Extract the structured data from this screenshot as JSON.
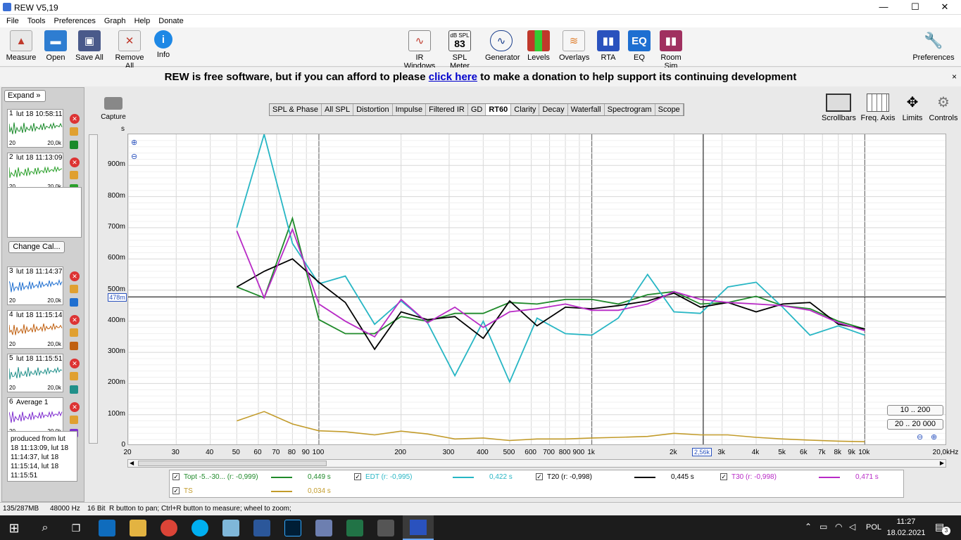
{
  "window": {
    "title": "REW V5,19",
    "min": "—",
    "max": "☐",
    "close": "✕"
  },
  "menu": [
    "File",
    "Tools",
    "Preferences",
    "Graph",
    "Help",
    "Donate"
  ],
  "toolbar": {
    "left": [
      {
        "label": "Measure",
        "icon": "measure-icon",
        "color": "#c0392b"
      },
      {
        "label": "Open",
        "icon": "folder-icon",
        "color": "#2e7dd1"
      },
      {
        "label": "Save All",
        "icon": "save-icon",
        "color": "#4a5a8a"
      },
      {
        "label": "Remove All",
        "icon": "remove-icon",
        "color": "#c0392b"
      },
      {
        "label": "Info",
        "icon": "info-icon",
        "color": "#1e88e5"
      }
    ],
    "center": [
      {
        "label": "IR Windows",
        "icon": "ir-windows-icon",
        "color": "#c0392b"
      },
      {
        "label": "SPL Meter",
        "icon": "spl-meter-icon",
        "color": "#333",
        "top": "dB SPL",
        "value": "83"
      },
      {
        "label": "Generator",
        "icon": "generator-icon",
        "color": "#1a3e8c"
      },
      {
        "label": "Levels",
        "icon": "levels-icon",
        "color": "#c0392b"
      },
      {
        "label": "Overlays",
        "icon": "overlays-icon",
        "color": "#e08030"
      },
      {
        "label": "RTA",
        "icon": "rta-icon",
        "color": "#2a52be"
      },
      {
        "label": "EQ",
        "icon": "eq-icon",
        "color": "#1e6fd1"
      },
      {
        "label": "Room Sim",
        "icon": "room-sim-icon",
        "color": "#a03060"
      }
    ],
    "right": {
      "label": "Preferences",
      "icon": "wrench-icon"
    }
  },
  "donate": {
    "pre": "REW is free software, but if you can afford to please ",
    "link": "click here",
    "post": " to make a donation to help support its continuing development",
    "close": "×"
  },
  "left_panel": {
    "expand": "Expand",
    "change_cal": "Change Cal...",
    "measurements": [
      {
        "num": "1",
        "date": "lut 18 10:58:11",
        "lo": "20",
        "hi": "20,0k",
        "color": "#1a8a2a"
      },
      {
        "num": "2",
        "date": "lut 18 11:13:09",
        "lo": "20",
        "hi": "20,0k",
        "color": "#2aa02a"
      },
      {
        "num": "3",
        "date": "lut 18 11:14:37",
        "lo": "20",
        "hi": "20,0k",
        "color": "#1f6fd0"
      },
      {
        "num": "4",
        "date": "lut 18 11:15:14",
        "lo": "20",
        "hi": "20,0k",
        "color": "#c06010"
      },
      {
        "num": "5",
        "date": "lut 18 11:15:51",
        "lo": "20",
        "hi": "20,0k",
        "color": "#20908a"
      },
      {
        "num": "6",
        "date": "Average 1",
        "lo": "20",
        "hi": "20,0k",
        "color": "#8030d0"
      }
    ],
    "notes": [
      "produced from lut",
      "18 11:13:09, lut 18",
      "11:14:37, lut 18",
      "11:15:14, lut 18",
      "11:15:51"
    ]
  },
  "graph": {
    "capture": "Capture",
    "tabs": [
      "SPL & Phase",
      "All SPL",
      "Distortion",
      "Impulse",
      "Filtered IR",
      "GD",
      "RT60",
      "Clarity",
      "Decay",
      "Waterfall",
      "Spectrogram",
      "Scope"
    ],
    "active_tab": "RT60",
    "right_tools": [
      "Scrollbars",
      "Freq. Axis",
      "Limits",
      "Controls"
    ],
    "y_unit": "s",
    "cursor_y": "478m",
    "cursor_x": "2,56k",
    "range_buttons": [
      "10 .. 200",
      "20 .. 20 000"
    ]
  },
  "chart_data": {
    "type": "line",
    "x_scale": "log",
    "xlim": [
      20,
      20000
    ],
    "ylim": [
      0,
      1
    ],
    "y_ticks": [
      {
        "v": 0,
        "label": "0"
      },
      {
        "v": 0.1,
        "label": "100m"
      },
      {
        "v": 0.2,
        "label": "200m"
      },
      {
        "v": 0.3,
        "label": "300m"
      },
      {
        "v": 0.4,
        "label": "400m"
      },
      {
        "v": 0.5,
        "label": "500m"
      },
      {
        "v": 0.6,
        "label": "600m"
      },
      {
        "v": 0.7,
        "label": "700m"
      },
      {
        "v": 0.8,
        "label": "800m"
      },
      {
        "v": 0.9,
        "label": "900m"
      }
    ],
    "x_ticks": [
      {
        "v": 20,
        "label": "20"
      },
      {
        "v": 30,
        "label": "30"
      },
      {
        "v": 40,
        "label": "40"
      },
      {
        "v": 50,
        "label": "50"
      },
      {
        "v": 60,
        "label": "60"
      },
      {
        "v": 70,
        "label": "70"
      },
      {
        "v": 80,
        "label": "80"
      },
      {
        "v": 90,
        "label": "90"
      },
      {
        "v": 100,
        "label": "100"
      },
      {
        "v": 200,
        "label": "200"
      },
      {
        "v": 300,
        "label": "300"
      },
      {
        "v": 400,
        "label": "400"
      },
      {
        "v": 500,
        "label": "500"
      },
      {
        "v": 600,
        "label": "600"
      },
      {
        "v": 700,
        "label": "700"
      },
      {
        "v": 800,
        "label": "800"
      },
      {
        "v": 900,
        "label": "900"
      },
      {
        "v": 1000,
        "label": "1k"
      },
      {
        "v": 2000,
        "label": "2k"
      },
      {
        "v": 3000,
        "label": "3k"
      },
      {
        "v": 4000,
        "label": "4k"
      },
      {
        "v": 5000,
        "label": "5k"
      },
      {
        "v": 6000,
        "label": "6k"
      },
      {
        "v": 7000,
        "label": "7k"
      },
      {
        "v": 8000,
        "label": "8k"
      },
      {
        "v": 9000,
        "label": "9k"
      },
      {
        "v": 10000,
        "label": "10k"
      },
      {
        "v": 20000,
        "label": "20,0kHz"
      }
    ],
    "x": [
      50,
      63,
      80,
      100,
      125,
      160,
      200,
      250,
      315,
      400,
      500,
      630,
      800,
      1000,
      1250,
      1600,
      2000,
      2500,
      3150,
      4000,
      5000,
      6300,
      8000,
      10000
    ],
    "cursor": {
      "x": 2560,
      "y": 0.478
    },
    "series": [
      {
        "name": "Topt -5..-30... (r: -0,999)",
        "value": "0,449 s",
        "color": "#1f8a2a",
        "y": [
          0.51,
          0.475,
          0.73,
          0.405,
          0.36,
          0.36,
          0.415,
          0.4,
          0.425,
          0.425,
          0.46,
          0.455,
          0.47,
          0.47,
          0.455,
          0.485,
          0.495,
          0.455,
          0.46,
          0.48,
          0.45,
          0.44,
          0.4,
          0.375
        ]
      },
      {
        "name": "EDT (r: -0,995)",
        "value": "0,422 s",
        "color": "#27b6c4",
        "y": [
          0.7,
          1.0,
          0.65,
          0.52,
          0.545,
          0.39,
          0.465,
          0.395,
          0.225,
          0.4,
          0.205,
          0.41,
          0.36,
          0.355,
          0.41,
          0.55,
          0.43,
          0.425,
          0.51,
          0.525,
          0.445,
          0.355,
          0.385,
          0.355
        ]
      },
      {
        "name": "T20 (r: -0,998)",
        "value": "0,445 s",
        "color": "#000000",
        "y": [
          0.51,
          0.56,
          0.6,
          0.525,
          0.46,
          0.31,
          0.43,
          0.405,
          0.415,
          0.345,
          0.465,
          0.385,
          0.445,
          0.44,
          0.45,
          0.465,
          0.49,
          0.445,
          0.46,
          0.43,
          0.455,
          0.46,
          0.39,
          0.375
        ]
      },
      {
        "name": "T30 (r: -0,998)",
        "value": "0,471 s",
        "color": "#b82ac6",
        "y": [
          0.69,
          0.475,
          0.695,
          0.455,
          0.4,
          0.35,
          0.47,
          0.395,
          0.445,
          0.38,
          0.43,
          0.44,
          0.455,
          0.435,
          0.435,
          0.455,
          0.495,
          0.47,
          0.46,
          0.455,
          0.45,
          0.435,
          0.395,
          0.37
        ]
      },
      {
        "name": "TS",
        "value": "0,034 s",
        "color": "#c29b2a",
        "y": [
          0.08,
          0.11,
          0.07,
          0.048,
          0.045,
          0.035,
          0.047,
          0.038,
          0.022,
          0.025,
          0.017,
          0.022,
          0.022,
          0.025,
          0.027,
          0.03,
          0.04,
          0.035,
          0.035,
          0.027,
          0.022,
          0.018,
          0.015,
          0.013
        ]
      }
    ]
  },
  "status": {
    "mem": "135/287MB",
    "rate": "48000 Hz",
    "bits": "16 Bit",
    "hint": "R button to pan; Ctrl+R button to measure; wheel to zoom;"
  },
  "taskbar": {
    "lang": "POL",
    "time": "11:27",
    "date": "18.02.2021",
    "notif": "3"
  }
}
